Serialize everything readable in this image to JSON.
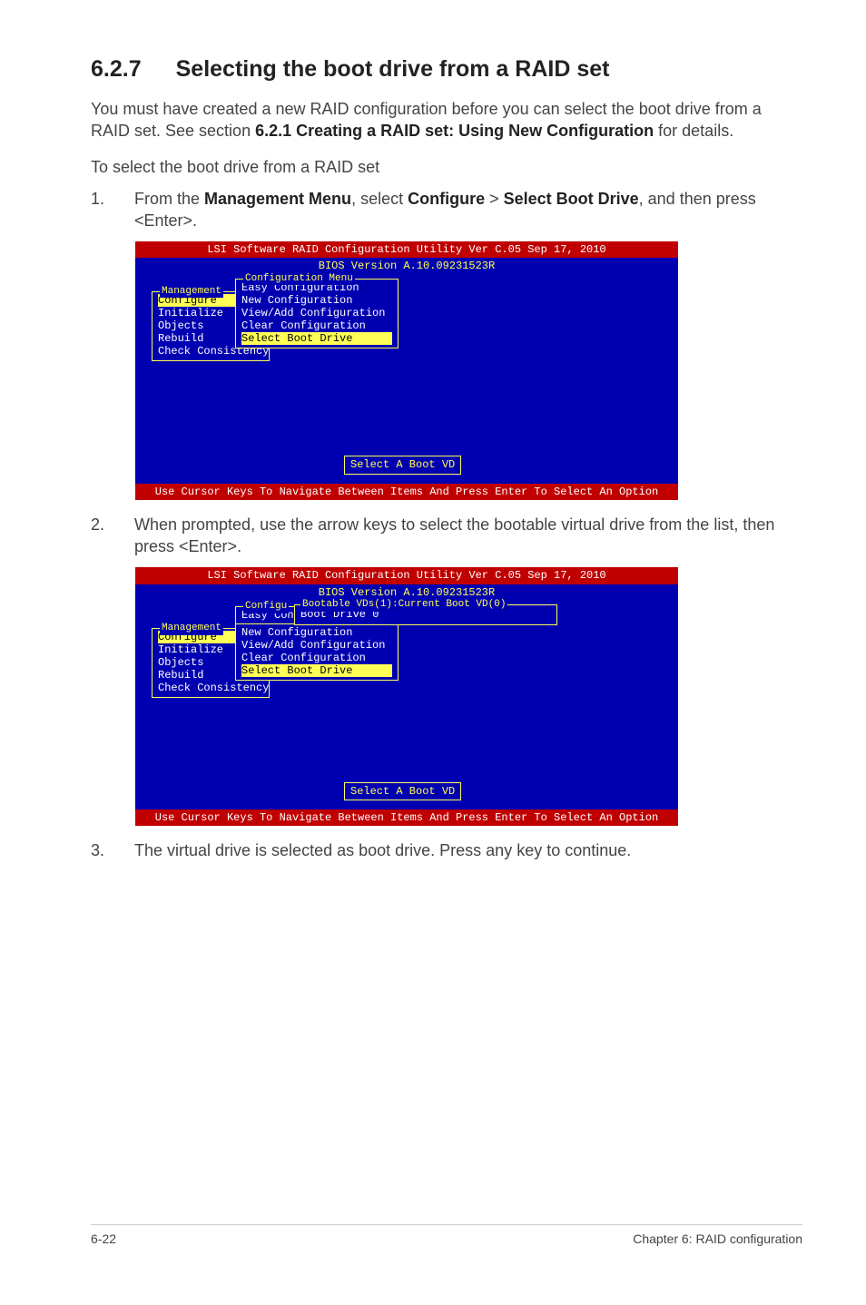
{
  "heading": {
    "num": "6.2.7",
    "title": "Selecting the boot drive from a RAID set"
  },
  "intro": {
    "p1a": "You must have created a new RAID configuration before you can select the boot drive from a RAID set. See section ",
    "p1b": "6.2.1 Creating a RAID set: Using New Configuration",
    "p1c": " for details.",
    "p2": "To select the boot drive from a RAID set"
  },
  "steps": {
    "s1": {
      "num": "1.",
      "a": "From the ",
      "b": "Management Menu",
      "c": ", select ",
      "d": "Configure",
      "e": " > ",
      "f": "Select Boot Drive",
      "g": ", and then press <Enter>."
    },
    "s2": {
      "num": "2.",
      "txt": "When prompted, use the arrow keys to select the bootable virtual drive from the list, then press <Enter>."
    },
    "s3": {
      "num": "3.",
      "txt": "The virtual drive is selected as boot drive. Press any key to continue."
    }
  },
  "bios": {
    "title": "LSI Software RAID Configuration Utility Ver C.05 Sep 17, 2010",
    "version": "BIOS Version  A.10.09231523R",
    "help": "Use Cursor Keys To Navigate Between Items And Press Enter To Select An Option",
    "prompt": "Select A Boot VD",
    "mgmt": {
      "label": "Management",
      "items": [
        "Configure",
        "Initialize",
        "Objects",
        "Rebuild",
        "Check Consistency"
      ]
    },
    "cfg": {
      "label": "Configuration Menu",
      "items": [
        "Easy Configuration",
        "New Configuration",
        "View/Add Configuration",
        "Clear Configuration",
        "Select Boot Drive"
      ]
    },
    "cfg2_short": "Configu",
    "cfg2_easy": "Easy Con",
    "boot": {
      "label": "Bootable VDs(1):Current Boot VD(0)",
      "item": "Boot Drive 0"
    }
  },
  "footer": {
    "left": "6-22",
    "right": "Chapter 6: RAID configuration"
  }
}
